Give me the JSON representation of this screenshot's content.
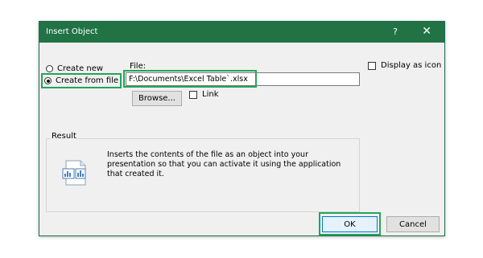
{
  "dialog": {
    "title": "Insert Object",
    "help_label": "?",
    "close_label": "✕"
  },
  "options": {
    "create_new_label": "Create new",
    "create_from_file_label": "Create from file",
    "selected": "create_from_file"
  },
  "file": {
    "label": "File:",
    "value": "F:\\Documents\\Excel Table`.xlsx",
    "browse_label": "Browse...",
    "link_label": "Link",
    "link_checked": false
  },
  "display_as_icon": {
    "label": "Display as icon",
    "checked": false
  },
  "result": {
    "legend": "Result",
    "text": "Inserts the contents of the file as an object into your presentation so that you can activate it using the application that created it."
  },
  "buttons": {
    "ok_label": "OK",
    "cancel_label": "Cancel"
  },
  "colors": {
    "titlebar": "#217346",
    "highlight": "#22a55a",
    "ok_border": "#0078d7"
  }
}
